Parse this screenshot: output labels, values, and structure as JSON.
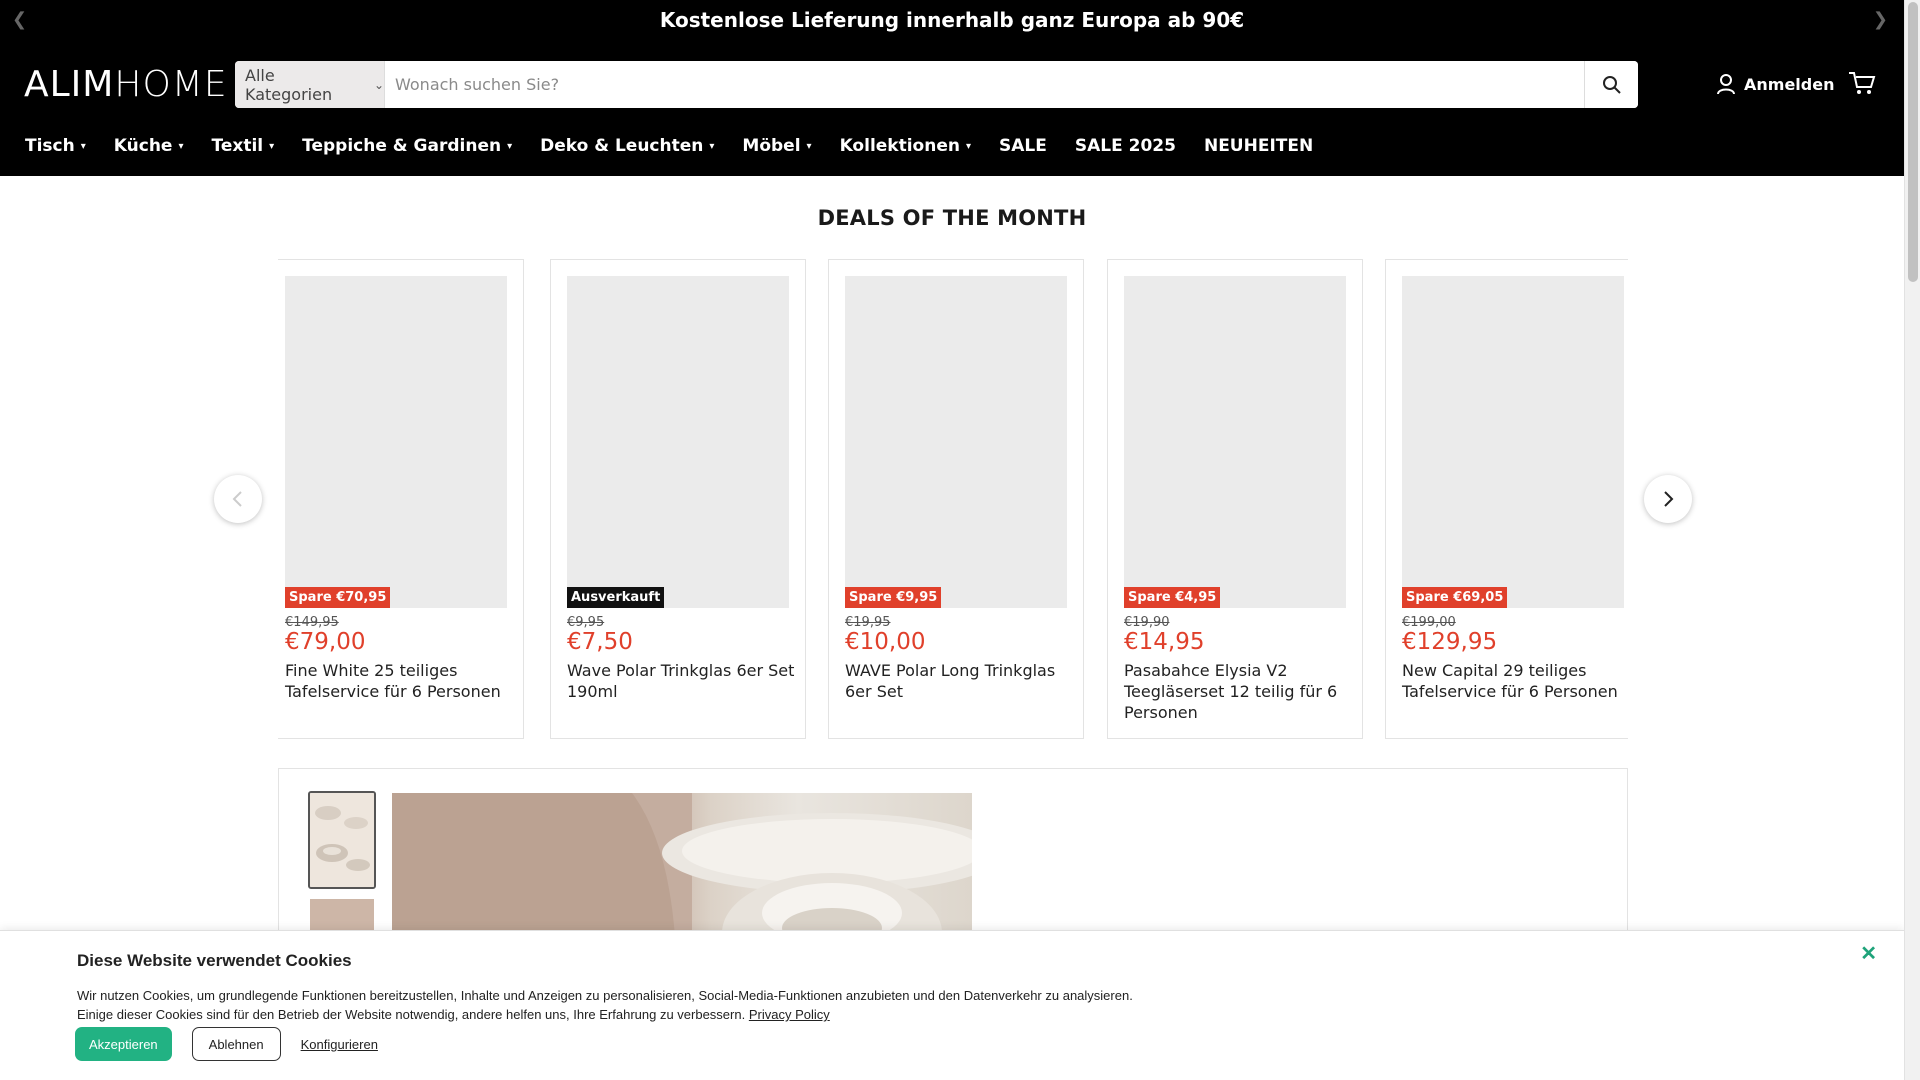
{
  "announcement": {
    "text": "Kostenlose Lieferung innerhalb ganz Europa ab 90€",
    "prev_icon": "chevron-left",
    "next_icon": "chevron-right"
  },
  "header": {
    "logo_left": "ALIM",
    "logo_right": "HOME",
    "search": {
      "category": "Alle Kategorien",
      "placeholder": "Wonach suchen Sie?",
      "icon": "search-icon"
    },
    "login_label": "Anmelden",
    "cart_icon": "cart-icon"
  },
  "nav": [
    {
      "label": "Tisch",
      "dropdown": true
    },
    {
      "label": "Küche",
      "dropdown": true
    },
    {
      "label": "Textil",
      "dropdown": true
    },
    {
      "label": "Teppiche & Gardinen",
      "dropdown": true
    },
    {
      "label": "Deko & Leuchten",
      "dropdown": true
    },
    {
      "label": "Möbel",
      "dropdown": true
    },
    {
      "label": "Kollektionen",
      "dropdown": true
    },
    {
      "label": "SALE",
      "dropdown": false
    },
    {
      "label": "SALE 2025",
      "dropdown": false
    },
    {
      "label": "NEUHEITEN",
      "dropdown": false
    }
  ],
  "deals": {
    "title": "DEALS OF THE MONTH",
    "products": [
      {
        "badge": "Spare €70,95",
        "badge_type": "sale",
        "old_price": "€149,95",
        "price": "€79,00",
        "name": "Fine White 25 teiliges Tafelservice für 6 Personen"
      },
      {
        "badge": "Ausverkauft",
        "badge_type": "sold",
        "old_price": "€9,95",
        "price": "€7,50",
        "name": "Wave Polar Trinkglas 6er Set 190ml"
      },
      {
        "badge": "Spare €9,95",
        "badge_type": "sale",
        "old_price": "€19,95",
        "price": "€10,00",
        "name": "WAVE Polar Long Trinkglas 6er Set"
      },
      {
        "badge": "Spare €4,95",
        "badge_type": "sale",
        "old_price": "€19,90",
        "price": "€14,95",
        "name": "Pasabahce Elysia V2 Teegläserset 12 teilig für 6 Personen"
      },
      {
        "badge": "Spare €69,05",
        "badge_type": "sale",
        "old_price": "€199,00",
        "price": "€129,95",
        "name": "New Capital 29 teiliges Tafelservice für 6 Personen"
      }
    ]
  },
  "cookie": {
    "title": "Diese Website verwendet Cookies",
    "line1": "Wir nutzen Cookies, um grundlegende Funktionen bereitzustellen, Inhalte und Anzeigen zu personalisieren, Social-Media-Funktionen anzubieten und den Datenverkehr zu analysieren.",
    "line2": "Einige dieser Cookies sind für den Betrieb der Website notwendig, andere helfen uns, Ihre Erfahrung zu verbessern.",
    "privacy_link": "Privacy Policy",
    "accept": "Akzeptieren",
    "reject": "Ablehnen",
    "configure": "Konfigurieren"
  },
  "colors": {
    "accent": "#e0402b",
    "header_bg": "#000000",
    "cookie_accept": "#22b283"
  }
}
